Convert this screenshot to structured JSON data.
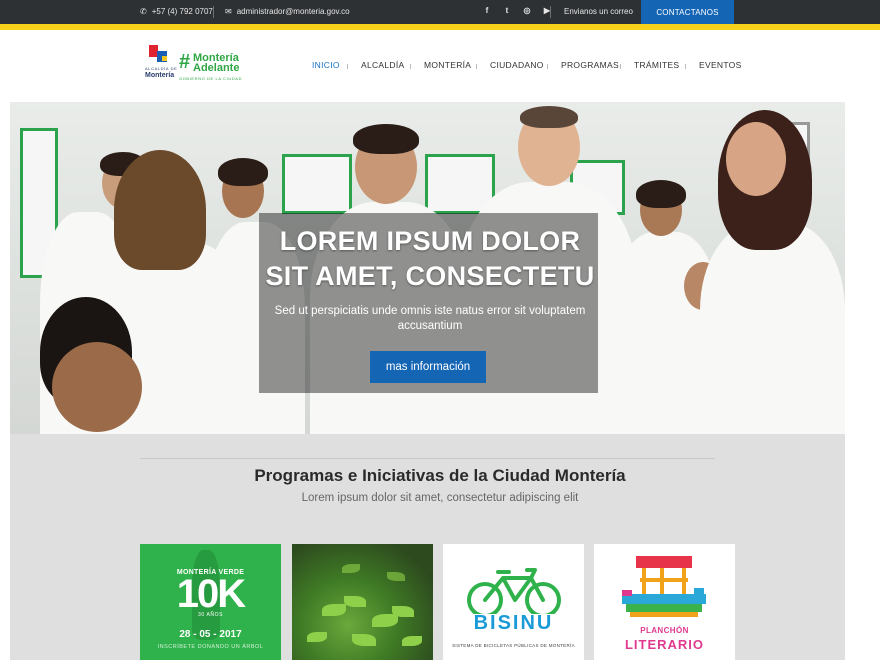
{
  "topbar": {
    "phone": "+57 (4) 792 0707",
    "email": "administrador@monteria.gov.co",
    "social_icons": [
      "facebook-icon",
      "twitter-icon",
      "instagram-icon",
      "youtube-icon"
    ],
    "send_email": "Envianos un correo",
    "contact_button": "CONTACTANOS"
  },
  "logo": {
    "small_text": "ALCALDÍA DE",
    "city": "Montería",
    "hashtag": "#",
    "line1": "Montería",
    "line2": "Adelante",
    "gov": "GOBIERNO DE LA CIUDAD"
  },
  "nav": {
    "items": [
      "INICIO",
      "ALCALDÍA",
      "MONTERÍA",
      "CIUDADANO",
      "PROGRAMAS",
      "TRÁMITES",
      "EVENTOS"
    ]
  },
  "hero": {
    "title_line1": "LOREM IPSUM DOLOR",
    "title_line2": "SIT AMET, CONSECTETU",
    "subtitle": "Sed ut perspiciatis unde omnis iste natus error sit voluptatem accusantium",
    "button": "mas información"
  },
  "programs": {
    "title": "Programas e Iniciativas de la Ciudad Montería",
    "subtitle": "Lorem ipsum dolor sit amet, consectetur adipiscing elit",
    "cards": {
      "green": {
        "title": "MONTERÍA VERDE",
        "big": "10K",
        "sub": "30 AÑOS",
        "date": "28 - 05 - 2017",
        "footer": "INSCRÍBETE DONANDO UN ÁRBOL"
      },
      "bici": {
        "name": "BISINU",
        "desc": "SISTEMA DE BICICLETAS PÚBLICAS DE MONTERÍA"
      },
      "plan": {
        "line1": "PLANCHÓN",
        "line2": "LITERARIO"
      }
    }
  },
  "colors": {
    "accent": "#1565b5",
    "topbar": "#2e3134",
    "yellow": "#f7d21b",
    "green": "#2fb24b"
  }
}
